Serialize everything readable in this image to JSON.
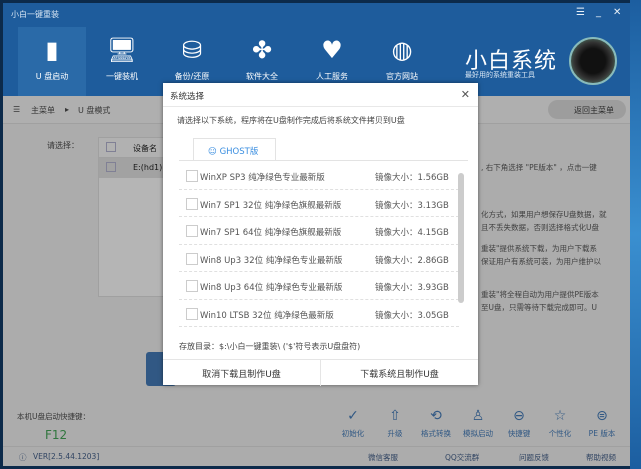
{
  "window": {
    "title": "小白一键重装",
    "controls": [
      "☰",
      "_",
      "✕"
    ]
  },
  "nav": [
    {
      "label": "U 盘启动",
      "icon": "usb-icon"
    },
    {
      "label": "一键装机",
      "icon": "monitor-icon"
    },
    {
      "label": "备份/还原",
      "icon": "database-icon"
    },
    {
      "label": "软件大全",
      "icon": "apps-icon"
    },
    {
      "label": "人工服务",
      "icon": "person-icon"
    },
    {
      "label": "官方网站",
      "icon": "globe-icon"
    }
  ],
  "brand": {
    "name": "小白系统",
    "slogan": "最好用的系统重装工具"
  },
  "breadcrumb": {
    "root": "主菜单",
    "current": "U 盘模式",
    "back": "返回主菜单"
  },
  "main": {
    "select_label": "请选择：",
    "col_device": "设备名",
    "device_row": "E:(hd1)I$",
    "desc": [
      ", 右下角选择 \"PE版本\" ，点击一键",
      "化方式，如果用户想保存U盘数据，就",
      "且不丢失数据，否则选择格式化U盘",
      "重装\"提供系统下载，为用户下载系",
      "保证用户有系统可装，为用户维护以",
      "重装\"将全程自动为用户提供PE版本",
      "至U盘，只需等待下载完成即可。U"
    ]
  },
  "shortcut": {
    "label": "本机U盘启动快捷键：",
    "key": "F12"
  },
  "tools": [
    {
      "label": "初始化",
      "icon": "check-circle-icon"
    },
    {
      "label": "升级",
      "icon": "arrow-up-circle-icon"
    },
    {
      "label": "格式转换",
      "icon": "convert-icon"
    },
    {
      "label": "模拟启动",
      "icon": "simulate-icon"
    },
    {
      "label": "快捷键",
      "icon": "mouse-icon"
    },
    {
      "label": "个性化",
      "icon": "star-icon"
    },
    {
      "label": "PE 版本",
      "icon": "pe-icon"
    }
  ],
  "footer": {
    "version": "VER[2.5.44.1203]",
    "wechat": "微信客服",
    "qq": "QQ交流群",
    "feedback": "问题反馈",
    "help": "帮助视频"
  },
  "dialog": {
    "title": "系统选择",
    "intro": "请选择以下系统，程序将在U盘制作完成后将系统文件拷贝到U盘",
    "tab": "GHOST版",
    "items": [
      {
        "name": "WinXP SP3 纯净绿色专业最新版",
        "size": "镜像大小：1.56GB"
      },
      {
        "name": "Win7 SP1 32位 纯净绿色旗舰最新版",
        "size": "镜像大小：3.13GB"
      },
      {
        "name": "Win7 SP1 64位 纯净绿色旗舰最新版",
        "size": "镜像大小：4.15GB"
      },
      {
        "name": "Win8 Up3 32位 纯净绿色专业最新版",
        "size": "镜像大小：2.86GB"
      },
      {
        "name": "Win8 Up3 64位 纯净绿色专业最新版",
        "size": "镜像大小：3.93GB"
      },
      {
        "name": "Win10 LTSB 32位 纯净绿色最新版",
        "size": "镜像大小：3.05GB"
      }
    ],
    "path": "存放目录：$:\\小白一键重装\\ ('$'符号表示U盘盘符)",
    "cancel": "取消下载且制作U盘",
    "confirm": "下载系统且制作U盘"
  },
  "colors": {
    "header": "#1e5c9c",
    "accent": "#2a6ab0",
    "key": "#2a9a40",
    "tab": "#3a8ee0"
  }
}
